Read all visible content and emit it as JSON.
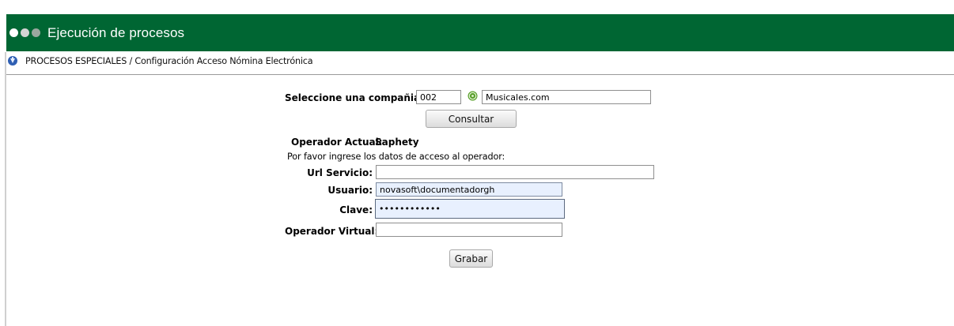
{
  "header": {
    "title": "Ejecución de procesos"
  },
  "breadcrumb": {
    "text": "PROCESOS ESPECIALES / Configuración Acceso Nómina Electrónica"
  },
  "company": {
    "label": "Seleccione una compañia:",
    "code": "002",
    "name": "Musicales.com"
  },
  "consult_button": "Consultar",
  "operator": {
    "label": "Operador Actual:",
    "value": "Saphety"
  },
  "instructions": "Por favor ingrese los datos de acceso al operador:",
  "fields": {
    "url_label": "Url Servicio:",
    "url_value": "",
    "user_label": "Usuario:",
    "user_value": "novasoft\\documentadorgh",
    "password_label": "Clave:",
    "password_value": "documentador",
    "virtual_label": "Operador Virtual:",
    "virtual_value": ""
  },
  "save_button": "Grabar",
  "colors": {
    "header_bg": "#006633",
    "accent_help": "#5aa02c"
  },
  "icons": {
    "header": "traffic-dots-icon",
    "breadcrumb": "info-arrow-icon",
    "help": "help-icon"
  }
}
